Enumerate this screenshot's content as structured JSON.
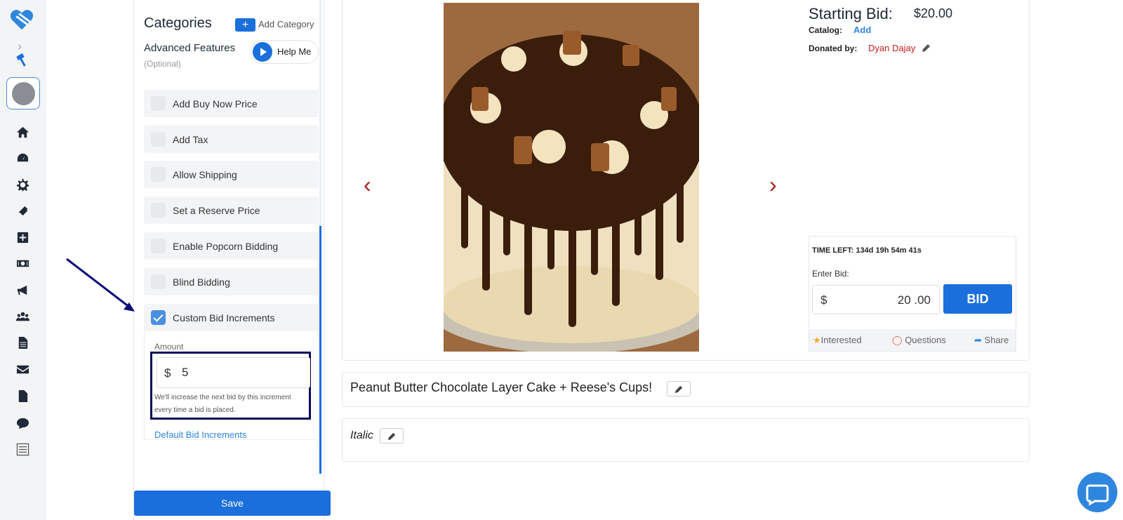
{
  "panel": {
    "categories_title": "Categories",
    "add_category_icon": "+",
    "add_category_label": "Add Category",
    "advanced_title": "Advanced Features",
    "advanced_subtitle": "(Optional)",
    "help_label": "Help Me",
    "features": [
      {
        "label": "Add Buy Now Price",
        "checked": false
      },
      {
        "label": "Add Tax",
        "checked": false
      },
      {
        "label": "Allow Shipping",
        "checked": false
      },
      {
        "label": "Set a Reserve Price",
        "checked": false
      },
      {
        "label": "Enable Popcorn Bidding",
        "checked": false
      },
      {
        "label": "Blind Bidding",
        "checked": false
      },
      {
        "label": "Custom Bid Increments",
        "checked": true
      }
    ],
    "amount_label": "Amount",
    "amount_currency": "$",
    "amount_value": "5",
    "amount_hint": "We'll increase the next bid by this increment every time a bid is placed.",
    "default_increments_link": "Default Bid Increments",
    "save_label": "Save"
  },
  "item": {
    "starting_bid_label": "Starting Bid:",
    "starting_bid_value": "$20.00",
    "catalog_label": "Catalog:",
    "catalog_add": "Add",
    "donated_label": "Donated by:",
    "donor_name": "Dyan Dajay",
    "prev_arrow": "‹",
    "next_arrow": "›",
    "time_left": "TIME LEFT: 134d 19h 54m 41s",
    "enter_bid_label": "Enter Bid:",
    "bid_currency": "$",
    "bid_value": "20 .00",
    "bid_button": "BID",
    "interested": "Interested",
    "questions": "Questions",
    "share": "Share",
    "title": "Peanut Butter Chocolate Layer Cake + Reese's Cups!",
    "description": "Italic"
  },
  "colors": {
    "accent": "#1a6fdc",
    "link": "#2f86de",
    "donor": "#c81e1e",
    "arrow": "#a51d1d",
    "highlight": "#0b0b5c"
  },
  "icons": [
    "logo-icon",
    "chevron-right-icon",
    "hammer-icon",
    "home-icon",
    "dashboard-icon",
    "gear-icon",
    "ticket-icon",
    "plus-square-icon",
    "money-icon",
    "megaphone-icon",
    "users-icon",
    "document-icon",
    "envelope-icon",
    "file-icon",
    "chat-bubble-icon",
    "sliders-icon",
    "pencil-icon",
    "star-icon",
    "comment-icon",
    "share-icon",
    "play-icon",
    "check-icon"
  ]
}
